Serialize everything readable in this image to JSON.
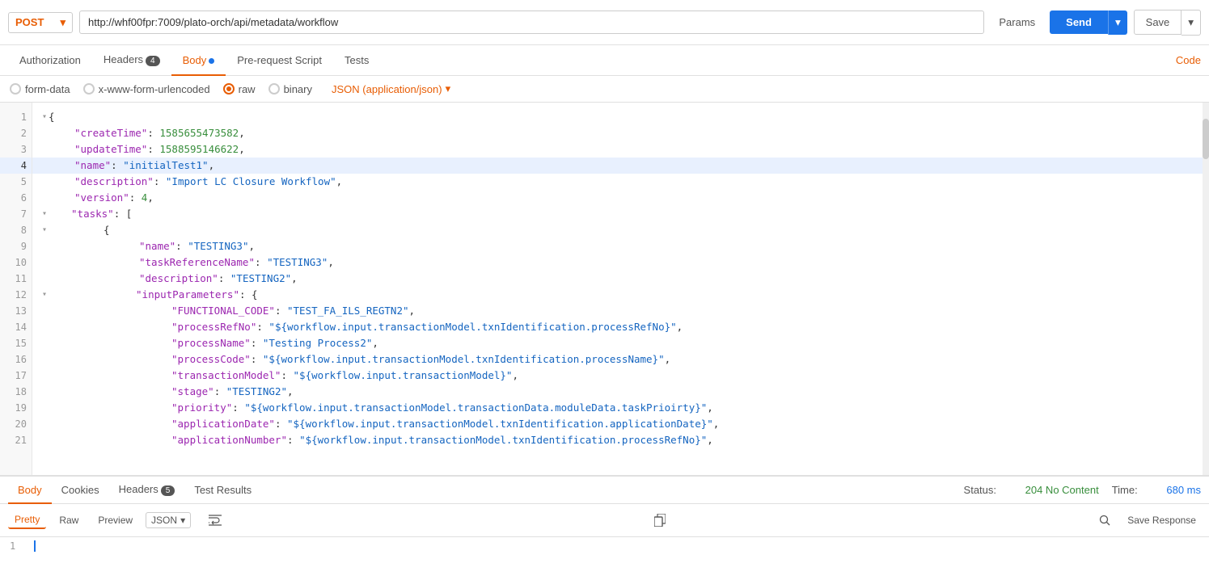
{
  "topbar": {
    "method": "POST",
    "url": "http://whf00fpr:7009/plato-orch/api/metadata/workflow",
    "params_label": "Params",
    "send_label": "Send",
    "save_label": "Save"
  },
  "request_tabs": {
    "authorization": "Authorization",
    "headers": "Headers",
    "headers_badge": "4",
    "body": "Body",
    "prerequest": "Pre-request Script",
    "tests": "Tests",
    "code": "Code"
  },
  "body_types": {
    "form_data": "form-data",
    "urlencoded": "x-www-form-urlencoded",
    "raw": "raw",
    "binary": "binary",
    "json_type": "JSON (application/json)"
  },
  "code_lines": [
    {
      "num": 1,
      "indent": 0,
      "content": "{",
      "type": "brace",
      "toggle": "▾"
    },
    {
      "num": 2,
      "indent": 1,
      "content": "\"createTime\": 1585655473582,",
      "key": "createTime",
      "val": "1585655473582",
      "val_type": "number"
    },
    {
      "num": 3,
      "indent": 1,
      "content": "\"updateTime\": 1588595146622,",
      "key": "updateTime",
      "val": "1588595146622",
      "val_type": "number"
    },
    {
      "num": 4,
      "indent": 1,
      "content": "\"name\": \"initialTest1\",",
      "key": "name",
      "val": "initialTest1",
      "val_type": "string",
      "highlighted": true
    },
    {
      "num": 5,
      "indent": 1,
      "content": "\"description\": \"Import LC Closure Workflow\",",
      "key": "description",
      "val": "Import LC Closure Workflow",
      "val_type": "string"
    },
    {
      "num": 6,
      "indent": 1,
      "content": "\"version\": 4,",
      "key": "version",
      "val": "4",
      "val_type": "number"
    },
    {
      "num": 7,
      "indent": 1,
      "content": "\"tasks\": [",
      "key": "tasks",
      "toggle": "▾"
    },
    {
      "num": 8,
      "indent": 2,
      "content": "{",
      "type": "brace",
      "toggle": "▾"
    },
    {
      "num": 9,
      "indent": 3,
      "content": "\"name\": \"TESTING3\",",
      "key": "name",
      "val": "TESTING3",
      "val_type": "string"
    },
    {
      "num": 10,
      "indent": 3,
      "content": "\"taskReferenceName\": \"TESTING3\",",
      "key": "taskReferenceName",
      "val": "TESTING3",
      "val_type": "string"
    },
    {
      "num": 11,
      "indent": 3,
      "content": "\"description\": \"TESTING2\",",
      "key": "description",
      "val": "TESTING2",
      "val_type": "string"
    },
    {
      "num": 12,
      "indent": 3,
      "content": "\"inputParameters\": {",
      "key": "inputParameters",
      "toggle": "▾"
    },
    {
      "num": 13,
      "indent": 4,
      "content": "\"FUNCTIONAL_CODE\": \"TEST_FA_ILS_REGTN2\",",
      "key": "FUNCTIONAL_CODE",
      "val": "TEST_FA_ILS_REGTN2",
      "val_type": "string"
    },
    {
      "num": 14,
      "indent": 4,
      "content": "\"processRefNo\": \"${workflow.input.transactionModel.txnIdentification.processRefNo}\",",
      "key": "processRefNo",
      "val": "${workflow.input.transactionModel.txnIdentification.processRefNo}",
      "val_type": "string"
    },
    {
      "num": 15,
      "indent": 4,
      "content": "\"processName\": \"Testing Process2\",",
      "key": "processName",
      "val": "Testing Process2",
      "val_type": "string"
    },
    {
      "num": 16,
      "indent": 4,
      "content": "\"processCode\": \"${workflow.input.transactionModel.txnIdentification.processName}\",",
      "key": "processCode",
      "val": "${workflow.input.transactionModel.txnIdentification.processName}",
      "val_type": "string"
    },
    {
      "num": 17,
      "indent": 4,
      "content": "\"transactionModel\": \"${workflow.input.transactionModel}\",",
      "key": "transactionModel",
      "val": "${workflow.input.transactionModel}",
      "val_type": "string"
    },
    {
      "num": 18,
      "indent": 4,
      "content": "\"stage\": \"TESTING2\",",
      "key": "stage",
      "val": "TESTING2",
      "val_type": "string"
    },
    {
      "num": 19,
      "indent": 4,
      "content": "\"priority\": \"${workflow.input.transactionModel.transactionData.moduleData.taskPrioirty}\",",
      "key": "priority",
      "val": "${workflow.input.transactionModel.transactionData.moduleData.taskPrioirty}",
      "val_type": "string"
    },
    {
      "num": 20,
      "indent": 4,
      "content": "\"applicationDate\": \"${workflow.input.transactionModel.txnIdentification.applicationDate}\",",
      "key": "applicationDate",
      "val": "${workflow.input.transactionModel.txnIdentification.applicationDate}",
      "val_type": "string"
    },
    {
      "num": 21,
      "indent": 4,
      "content": "\"applicationNumber\": \"${workflow.input.transactionModel.txnIdentification.processRefNo}\",",
      "key": "applicationNumber",
      "val": "${workflow.input.transactionModel.txnIdentification.processRefNo}",
      "val_type": "string"
    }
  ],
  "response": {
    "tabs": {
      "body": "Body",
      "cookies": "Cookies",
      "headers": "Headers",
      "headers_badge": "5",
      "test_results": "Test Results"
    },
    "status_label": "Status:",
    "status_value": "204 No Content",
    "time_label": "Time:",
    "time_value": "680 ms",
    "toolbar": {
      "pretty": "Pretty",
      "raw": "Raw",
      "preview": "Preview",
      "format": "JSON",
      "save_response": "Save Response"
    },
    "line1": "1"
  }
}
